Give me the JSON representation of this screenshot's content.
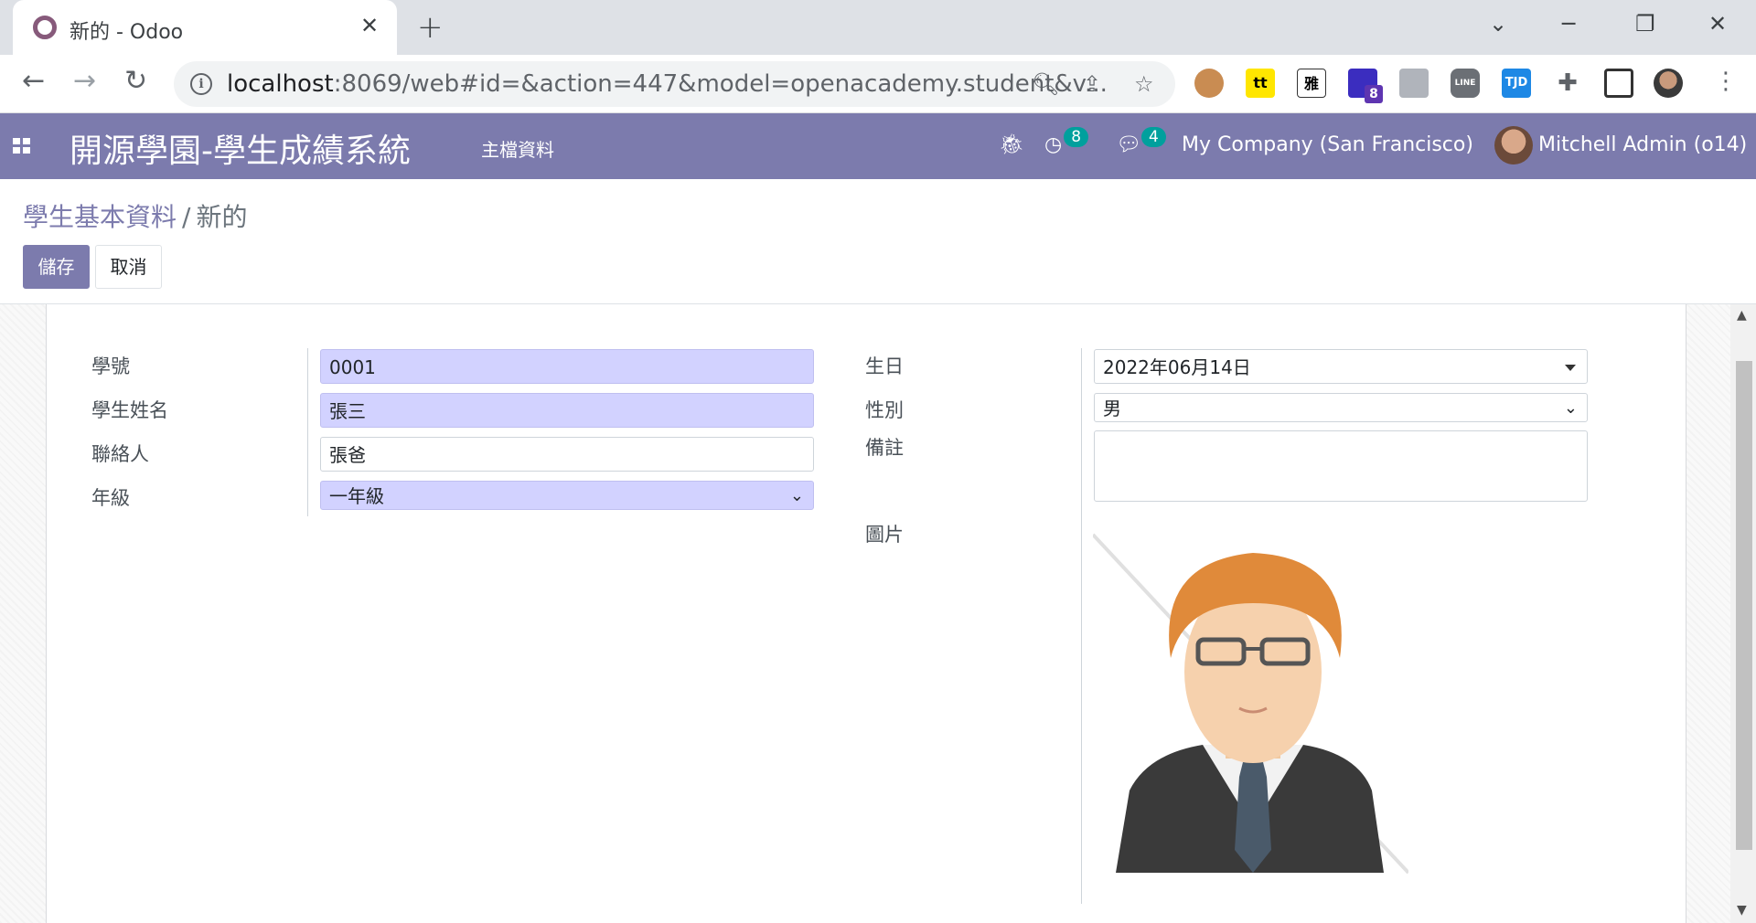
{
  "browser": {
    "tab_title": "新的 - Odoo",
    "url_host": "localhost",
    "url_rest": ":8069/web#id=&action=447&model=openacademy.student&v...",
    "extensions": [
      "monkey-extension",
      "tt-extension",
      "雅",
      "dictionary-extension-8",
      "person-extension",
      "LINE",
      "TJD",
      "puzzle-icon",
      "screenshot-extension"
    ],
    "ext_yah": "雅",
    "ext_badge": "8",
    "ext_line": "LINE",
    "ext_tjd": "TJD"
  },
  "navbar": {
    "brand": "開源學園-學生成績系統",
    "menu": "主檔資料",
    "activity_count": "8",
    "message_count": "4",
    "company": "My Company (San Francisco)",
    "user": "Mitchell Admin (o14)"
  },
  "breadcrumb": {
    "parent": "學生基本資料",
    "separator": "/",
    "current": "新的"
  },
  "buttons": {
    "save": "儲存",
    "cancel": "取消"
  },
  "form": {
    "left": {
      "student_no_label": "學號",
      "student_no_value": "0001",
      "name_label": "學生姓名",
      "name_value": "張三",
      "contact_label": "聯絡人",
      "contact_value": "張爸",
      "grade_label": "年級",
      "grade_value": "一年級"
    },
    "right": {
      "birthday_label": "生日",
      "birthday_value": "2022年06月14日",
      "gender_label": "性別",
      "gender_value": "男",
      "notes_label": "備註",
      "notes_value": "",
      "image_label": "圖片"
    }
  },
  "colors": {
    "odoo_primary": "#7c7bad",
    "required_field": "#d2d2ff",
    "badge": "#00a09d"
  }
}
